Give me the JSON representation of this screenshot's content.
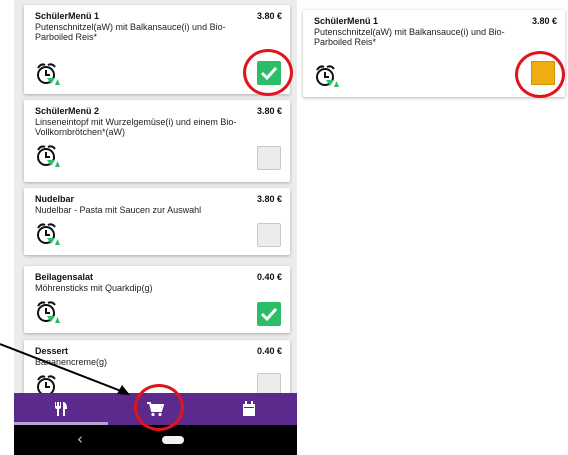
{
  "menu": {
    "items": [
      {
        "title": "SchülerMenü 1",
        "price": "3.80 €",
        "description": "Putenschnitzel(aW) mit Balkansauce(i) und Bio-Parboiled Reis*",
        "selected": true,
        "icon": "alarm-clock-icon"
      },
      {
        "title": "SchülerMenü 2",
        "price": "3.80 €",
        "description": "Linseneintopf mit Wurzelgemüse(i) und einem Bio-Vollkornbrötchen*(aW)",
        "selected": false,
        "icon": "alarm-clock-icon"
      },
      {
        "title": "Nudelbar",
        "price": "3.80 €",
        "description": "Nudelbar - Pasta mit Saucen zur Auswahl",
        "selected": false,
        "icon": "alarm-clock-icon"
      },
      {
        "title": "Beilagensalat",
        "price": "0.40 €",
        "description": "Möhrensticks mit Quarkdip(g)",
        "selected": true,
        "icon": "alarm-clock-icon"
      },
      {
        "title": "Dessert",
        "price": "0.40 €",
        "description": "Bananencreme(g)",
        "selected": false,
        "icon": "alarm-clock-icon"
      }
    ]
  },
  "bottom_nav": {
    "tabs": [
      {
        "name": "menu",
        "icon": "fork-knife-icon",
        "active": true
      },
      {
        "name": "cart",
        "icon": "cart-icon",
        "active": false
      },
      {
        "name": "calendar",
        "icon": "calendar-icon",
        "active": false
      }
    ]
  },
  "system_nav": {
    "back": "‹"
  },
  "detail_card": {
    "title": "SchülerMenü 1",
    "price": "3.80 €",
    "description": "Putenschnitzel(aW) mit Balkansauce(i) und Bio-Parboiled Reis*",
    "status": "pending",
    "status_color": "#f0ad12"
  },
  "colors": {
    "nav_bg": "#5b2a8c",
    "checked": "#2bbd68",
    "annotation": "#e0141a",
    "clock_arrow": "#2bbd68"
  }
}
